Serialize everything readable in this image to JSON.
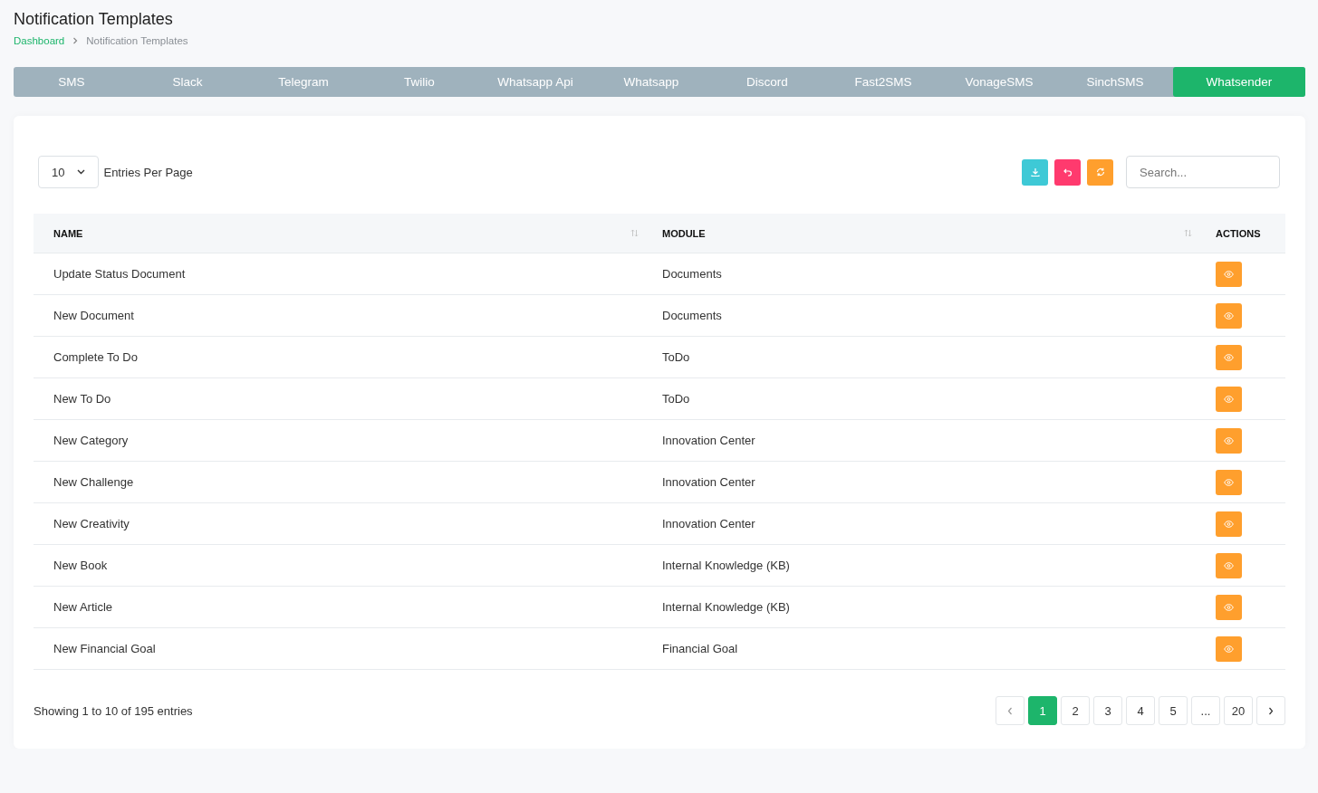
{
  "page": {
    "title": "Notification Templates"
  },
  "breadcrumb": [
    {
      "label": "Dashboard",
      "link": true
    },
    {
      "label": "Notification Templates",
      "link": false
    }
  ],
  "tabs": [
    {
      "label": "SMS",
      "selected": false
    },
    {
      "label": "Slack",
      "selected": false
    },
    {
      "label": "Telegram",
      "selected": false
    },
    {
      "label": "Twilio",
      "selected": false
    },
    {
      "label": "Whatsapp Api",
      "selected": false
    },
    {
      "label": "Whatsapp",
      "selected": false
    },
    {
      "label": "Discord",
      "selected": false
    },
    {
      "label": "Fast2SMS",
      "selected": false
    },
    {
      "label": "VonageSMS",
      "selected": false
    },
    {
      "label": "SinchSMS",
      "selected": false
    },
    {
      "label": "Whatsender",
      "selected": true
    }
  ],
  "entries": {
    "value": "10",
    "label": "Entries Per Page"
  },
  "toolbar": [
    {
      "kind": "download",
      "color": "#3ec9d6"
    },
    {
      "kind": "undo",
      "color": "#ff3a6e"
    },
    {
      "kind": "refresh",
      "color": "#ff9f2d"
    }
  ],
  "search": {
    "placeholder": "Search..."
  },
  "table": {
    "columns": [
      {
        "label": "NAME",
        "sortable": true
      },
      {
        "label": "MODULE",
        "sortable": true
      },
      {
        "label": "ACTIONS",
        "sortable": false
      }
    ],
    "rows": [
      {
        "name": "Update Status Document",
        "module": "Documents"
      },
      {
        "name": "New Document",
        "module": "Documents"
      },
      {
        "name": "Complete To Do",
        "module": "ToDo"
      },
      {
        "name": "New To Do",
        "module": "ToDo"
      },
      {
        "name": "New Category",
        "module": "Innovation Center"
      },
      {
        "name": "New Challenge",
        "module": "Innovation Center"
      },
      {
        "name": "New Creativity",
        "module": "Innovation Center"
      },
      {
        "name": "New Book",
        "module": "Internal Knowledge (KB)"
      },
      {
        "name": "New Article",
        "module": "Internal Knowledge (KB)"
      },
      {
        "name": "New Financial Goal",
        "module": "Financial Goal"
      }
    ]
  },
  "footer": {
    "summary": "Showing 1 to 10 of 195 entries"
  },
  "pagination": [
    {
      "label": "1",
      "selected": true
    },
    {
      "label": "2",
      "selected": false
    },
    {
      "label": "3",
      "selected": false
    },
    {
      "label": "4",
      "selected": false
    },
    {
      "label": "5",
      "selected": false
    },
    {
      "label": "...",
      "selected": false
    },
    {
      "label": "20",
      "selected": false
    }
  ]
}
